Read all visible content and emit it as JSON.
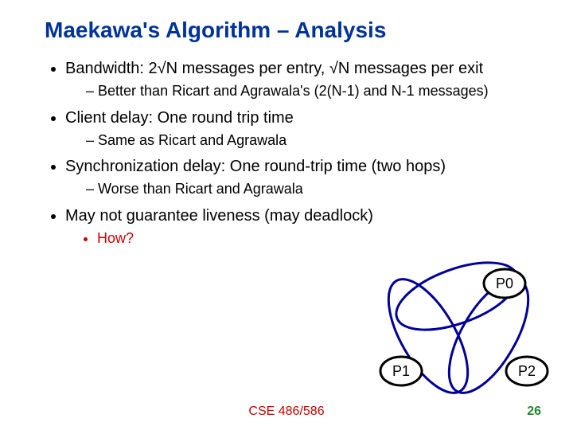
{
  "title": "Maekawa's Algorithm – Analysis",
  "bullets": {
    "b1": "Bandwidth: 2√N messages per entry, √N messages per exit",
    "b1a": "Better than Ricart and Agrawala's (2(N-1) and N-1 messages)",
    "b2": "Client delay: One round trip time",
    "b2a": "Same as Ricart and Agrawala",
    "b3": "Synchronization delay: One round-trip time (two hops)",
    "b3a": "Worse than Ricart and Agrawala",
    "b4": "May not guarantee liveness (may deadlock)",
    "b4a": "How?"
  },
  "diagram": {
    "p0": "P0",
    "p1": "P1",
    "p2": "P2"
  },
  "footer": {
    "course": "CSE 486/586",
    "page": "26"
  }
}
